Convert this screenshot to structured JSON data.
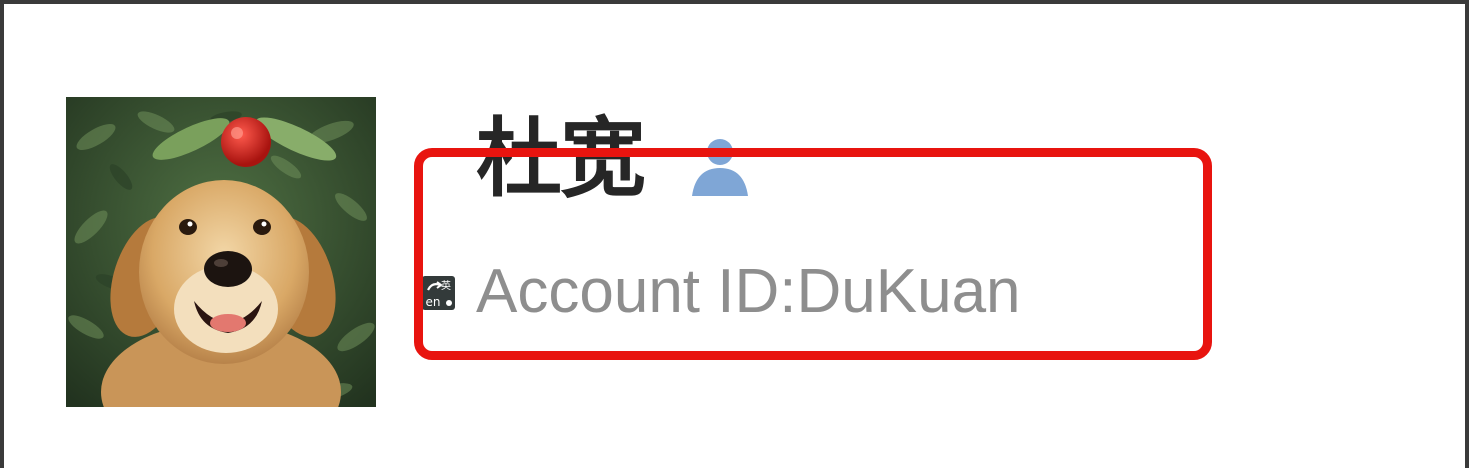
{
  "profile": {
    "display_name": "杜宽",
    "account_label": "Account ID:DuKuan",
    "avatar_icon": "golden-retriever-photo",
    "verified_icon": "person-icon"
  },
  "ime_indicator": {
    "icon": "ime-switch-icon",
    "top_text": "英",
    "bottom_text": "en"
  },
  "annotation": {
    "color": "#e8140f"
  },
  "colors": {
    "name_text": "#262626",
    "account_text": "#8e8e8e",
    "person_icon": "#7fa6d6"
  }
}
